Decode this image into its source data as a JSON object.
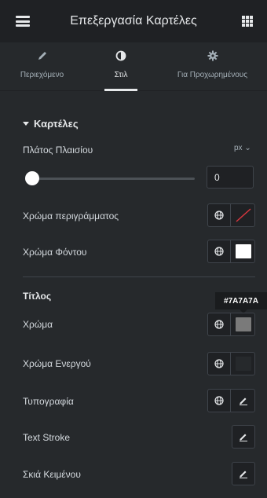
{
  "header": {
    "title": "Επεξεργασία Καρτέλες",
    "menu_icon": "hamburger-icon",
    "apps_icon": "grid-icon"
  },
  "tabs": [
    {
      "label": "Περιεχόμενο",
      "icon": "pencil-icon",
      "active": false
    },
    {
      "label": "Στιλ",
      "icon": "contrast-icon",
      "active": true
    },
    {
      "label": "Για Προχωρημένους",
      "icon": "gear-icon",
      "active": false
    }
  ],
  "section": {
    "title": "Καρτέλες"
  },
  "border_width": {
    "label": "Πλάτος Πλαισίου",
    "unit": "px",
    "value": "0",
    "slider_fraction": 0
  },
  "border_color": {
    "label": "Χρώμα περιγράμματος",
    "swatch": "none"
  },
  "background_color": {
    "label": "Χρώμα Φόντου",
    "swatch": "#FFFFFF"
  },
  "title_group": {
    "heading": "Τίτλος"
  },
  "tooltip": {
    "text": "#7A7A7A"
  },
  "title_color": {
    "label": "Χρώμα",
    "swatch": "#7A7A7A"
  },
  "active_color": {
    "label": "Χρώμα Ενεργού",
    "swatch": "#26292C"
  },
  "typography": {
    "label": "Τυπογραφία"
  },
  "text_stroke": {
    "label": "Text Stroke"
  },
  "text_shadow": {
    "label": "Σκιά Κειμένου"
  },
  "colors": {
    "panel": "#26292C",
    "header": "#1F2124",
    "text": "#D5DADF",
    "accent": "#FFFFFF"
  }
}
